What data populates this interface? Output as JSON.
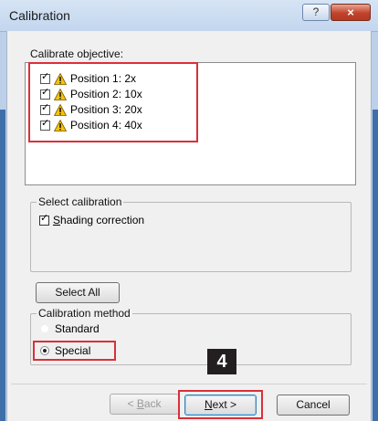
{
  "window": {
    "title": "Calibration",
    "help_glyph": "?",
    "close_glyph": "×"
  },
  "objective": {
    "label": "Calibrate objective:",
    "items": [
      {
        "label": "Position 1: 2x",
        "checked": true
      },
      {
        "label": "Position 2: 10x",
        "checked": true
      },
      {
        "label": "Position 3: 20x",
        "checked": true
      },
      {
        "label": "Position 4: 40x",
        "checked": true
      }
    ]
  },
  "select_calibration": {
    "legend": "Select calibration",
    "shading_prefix": "S",
    "shading_rest": "hading correction",
    "checked": true
  },
  "select_all_label": "Select All",
  "method": {
    "legend": "Calibration method",
    "standard": "Standard",
    "special": "Special",
    "selected": "Special"
  },
  "step_marker": "4",
  "buttons": {
    "back_mnemonic": "B",
    "back_rest": "ack",
    "back_prefix": "< ",
    "next_mnemonic": "N",
    "next_rest": "ext >",
    "cancel": "Cancel"
  },
  "colors": {
    "highlight": "#d9303a",
    "tick": "✓"
  }
}
